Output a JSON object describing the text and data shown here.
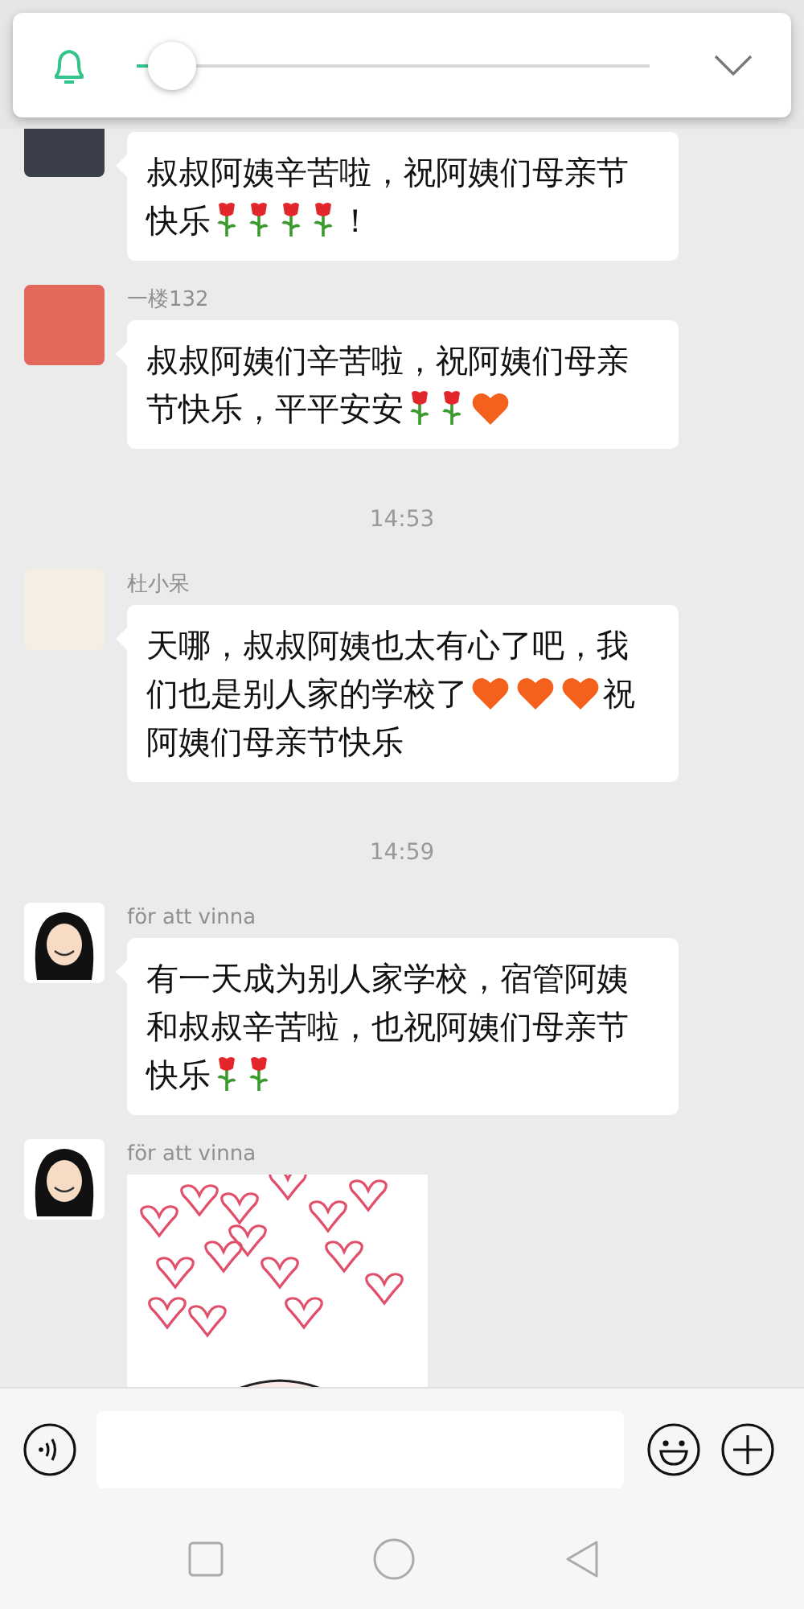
{
  "volume_panel": {
    "level": 0.07
  },
  "messages": [
    {
      "kind": "message",
      "parts": [
        {
          "kind": "text",
          "text": "叔叔阿姨辛苦啦，祝阿姨们母亲节"
        },
        {
          "kind": "text",
          "text": "快乐"
        },
        {
          "kind": "rose"
        },
        {
          "kind": "rose"
        },
        {
          "kind": "rose"
        },
        {
          "kind": "rose"
        },
        {
          "kind": "text",
          "text": "！"
        }
      ]
    },
    {
      "kind": "message",
      "sender": "一楼132",
      "parts": [
        {
          "kind": "text",
          "text": "叔叔阿姨们辛苦啦，祝阿姨们母亲"
        },
        {
          "kind": "text",
          "text": "节快乐，平平安安"
        },
        {
          "kind": "rose"
        },
        {
          "kind": "rose"
        },
        {
          "kind": "heart"
        }
      ]
    },
    {
      "kind": "time",
      "text": "14:53"
    },
    {
      "kind": "message",
      "sender": "杜小呆",
      "parts": [
        {
          "kind": "text",
          "text": "天哪，叔叔阿姨也太有心了吧，我"
        },
        {
          "kind": "text",
          "text": "们也是别人家的学校了"
        },
        {
          "kind": "heart"
        },
        {
          "kind": "heart"
        },
        {
          "kind": "heart"
        },
        {
          "kind": "text",
          "text": "祝"
        },
        {
          "kind": "text",
          "text": "阿姨们母亲节快乐"
        }
      ]
    },
    {
      "kind": "time",
      "text": "14:59"
    },
    {
      "kind": "message",
      "sender": "för att vinna",
      "parts": [
        {
          "kind": "text",
          "text": "有一天成为别人家学校，宿管阿姨"
        },
        {
          "kind": "text",
          "text": "和叔叔辛苦啦，也祝阿姨们母亲节"
        },
        {
          "kind": "text",
          "text": "快乐"
        },
        {
          "kind": "rose"
        },
        {
          "kind": "rose"
        }
      ]
    },
    {
      "kind": "sticker",
      "sender": "för att vinna"
    }
  ]
}
